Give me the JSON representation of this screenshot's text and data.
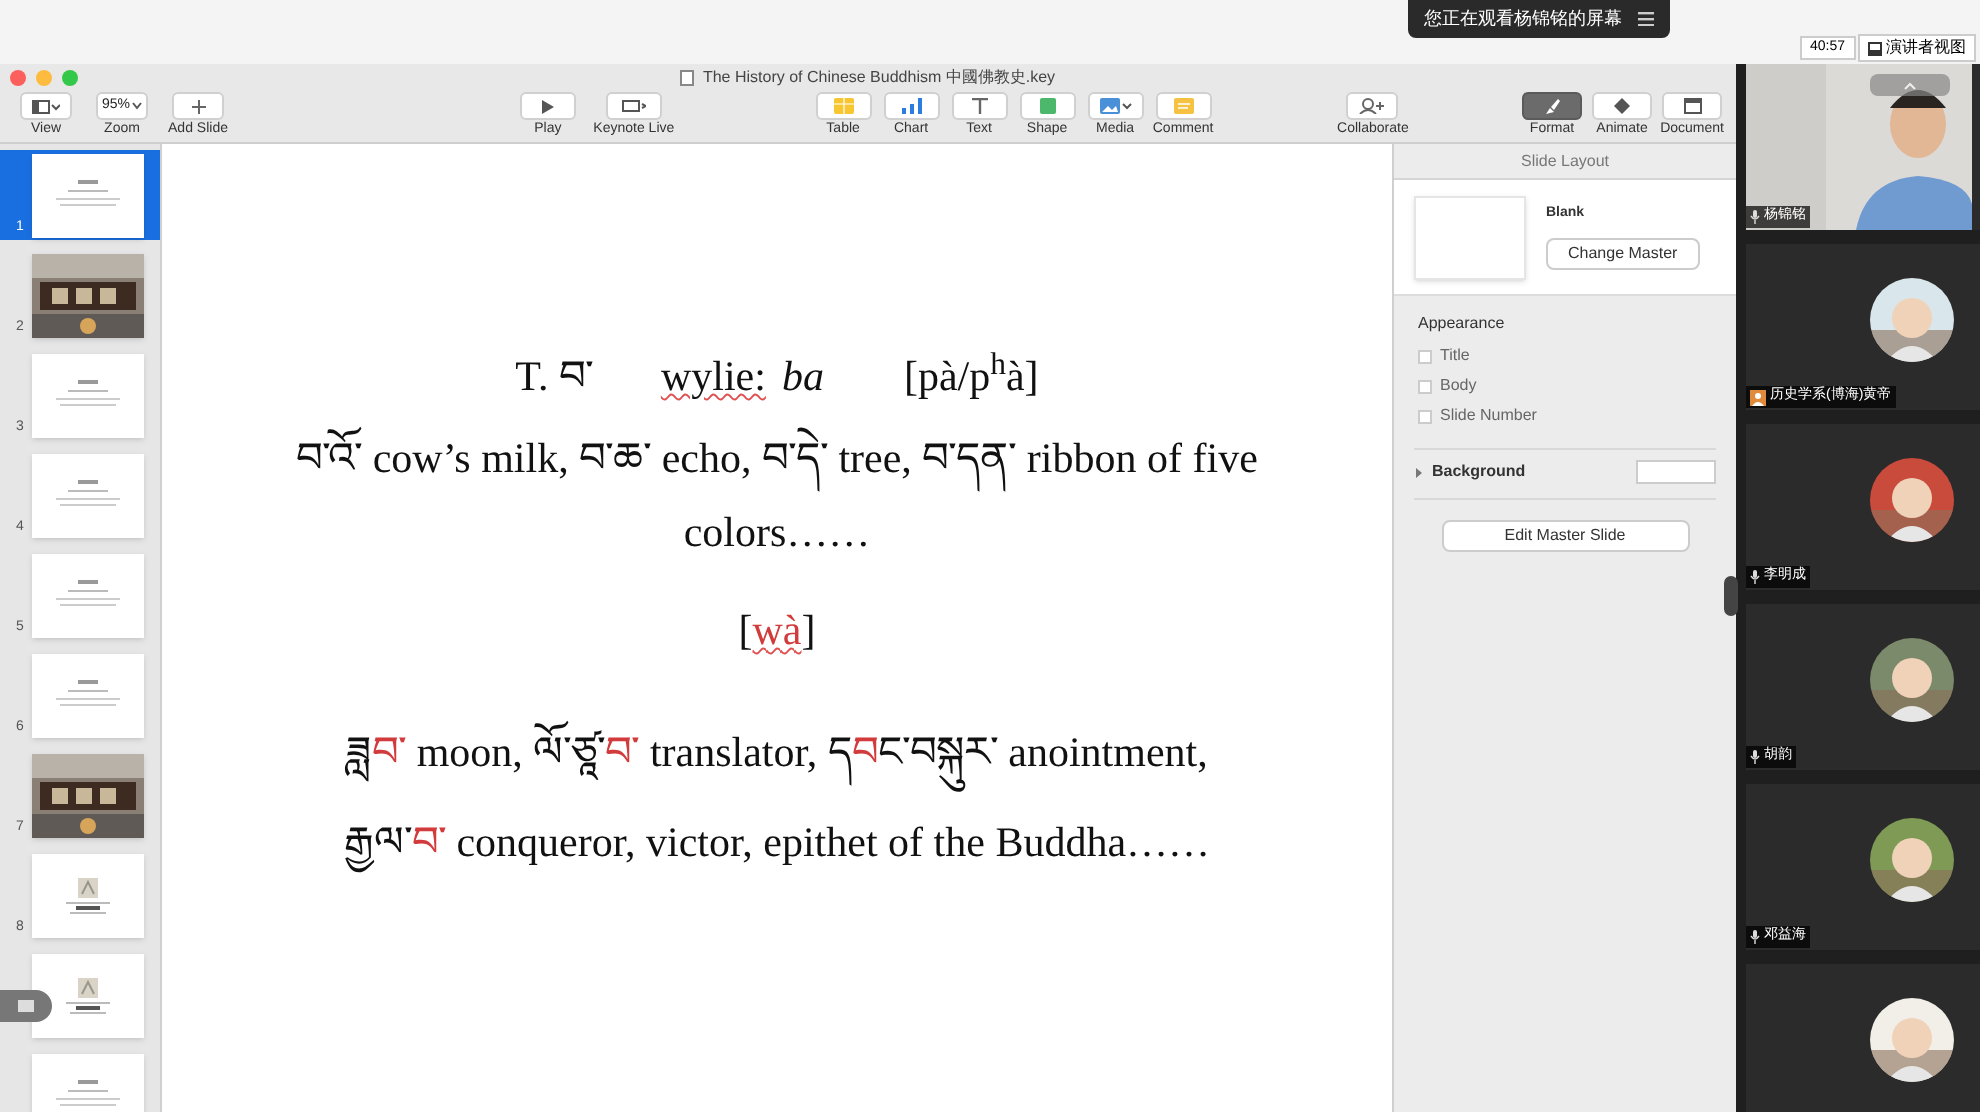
{
  "share_banner": {
    "text": "您正在观看杨锦铭的屏幕"
  },
  "meeting_bar": {
    "timer": "40:57",
    "view_button": "演讲者视图"
  },
  "window": {
    "title": "The History of Chinese Buddhism 中國佛教史.key"
  },
  "toolbar": {
    "left": [
      {
        "label": "View",
        "kind": "view"
      },
      {
        "label": "Zoom",
        "kind": "zoom",
        "value": "95%"
      },
      {
        "label": "Add Slide",
        "kind": "add"
      }
    ],
    "play": [
      {
        "label": "Play",
        "kind": "play"
      },
      {
        "label": "Keynote Live",
        "kind": "live"
      }
    ],
    "insert": [
      {
        "label": "Table",
        "kind": "table"
      },
      {
        "label": "Chart",
        "kind": "chart"
      },
      {
        "label": "Text",
        "kind": "text"
      },
      {
        "label": "Shape",
        "kind": "shape"
      },
      {
        "label": "Media",
        "kind": "media"
      },
      {
        "label": "Comment",
        "kind": "comment"
      }
    ],
    "collaborate": {
      "label": "Collaborate"
    },
    "panes": [
      {
        "label": "Format",
        "kind": "format",
        "selected": true
      },
      {
        "label": "Animate",
        "kind": "animate",
        "selected": false
      },
      {
        "label": "Document",
        "kind": "document",
        "selected": false
      }
    ]
  },
  "navigator": {
    "slides": [
      {
        "number": "1",
        "kind": "text",
        "selected": true
      },
      {
        "number": "2",
        "selected": false
      },
      {
        "number": "3",
        "kind": "text",
        "selected": false
      },
      {
        "number": "4",
        "kind": "text",
        "selected": false
      },
      {
        "number": "5",
        "kind": "text",
        "selected": false
      },
      {
        "number": "6",
        "kind": "text",
        "selected": false
      },
      {
        "number": "7",
        "selected": false
      },
      {
        "number": "8",
        "kind": "figure",
        "selected": false
      },
      {
        "kind": "figure",
        "selected": false
      },
      {
        "kind": "text",
        "selected": false
      }
    ]
  },
  "slide": {
    "lines": [
      [
        {
          "text": "T. བ་",
          "kind": "plain"
        },
        {
          "text": "wylie:",
          "kind": "flagged"
        },
        {
          "text": "ba",
          "kind": "italic"
        },
        {
          "text": "[pà/p$^{h}$à]",
          "kind": "plain"
        }
      ],
      [
        {
          "text": "བ་འོ་ cow’s milk, བ་ཆ་ echo, བ་དེ་ tree, བ་དན་ ribbon of five colors……",
          "kind": "plain"
        }
      ],
      [
        {
          "text": "[",
          "kind": "plain"
        },
        {
          "text": "wà",
          "kind": "red_flagged"
        },
        {
          "text": "]",
          "kind": "plain"
        }
      ],
      [
        {
          "text": "ཟླ",
          "kind": "plain"
        },
        {
          "text": "བ་",
          "kind": "red"
        },
        {
          "text": " moon, ལོ་ཙཱ་",
          "kind": "plain"
        },
        {
          "text": "བ་",
          "kind": "red"
        },
        {
          "text": " translator, ད",
          "kind": "plain"
        },
        {
          "text": "བ",
          "kind": "red"
        },
        {
          "text": "ང་བསྐུར་ anointment,",
          "kind": "plain"
        }
      ],
      [
        {
          "text": "རྒྱལ་",
          "kind": "plain"
        },
        {
          "text": "བ་",
          "kind": "red"
        },
        {
          "text": " conqueror, victor, epithet of the Buddha……",
          "kind": "plain"
        }
      ]
    ]
  },
  "inspector": {
    "title": "Slide Layout",
    "master_name": "Blank",
    "change_master": "Change Master",
    "appearance": "Appearance",
    "options": [
      {
        "label": "Title",
        "checked": false
      },
      {
        "label": "Body",
        "checked": false
      },
      {
        "label": "Slide Number",
        "checked": false
      }
    ],
    "background": {
      "label": "Background",
      "expanded": false
    },
    "edit_master": "Edit Master Slide"
  },
  "participants": [
    {
      "name": "杨锦铭",
      "kind": "camera",
      "profile_badge": false
    },
    {
      "name": "历史学系(博海)黄帝",
      "kind": "avatar",
      "profile_badge": true
    },
    {
      "name": "李明成",
      "kind": "avatar",
      "profile_badge": false
    },
    {
      "name": "胡韵",
      "kind": "avatar",
      "profile_badge": false
    },
    {
      "name": "邓益海",
      "kind": "avatar",
      "profile_badge": false
    },
    {
      "kind": "avatar"
    }
  ]
}
